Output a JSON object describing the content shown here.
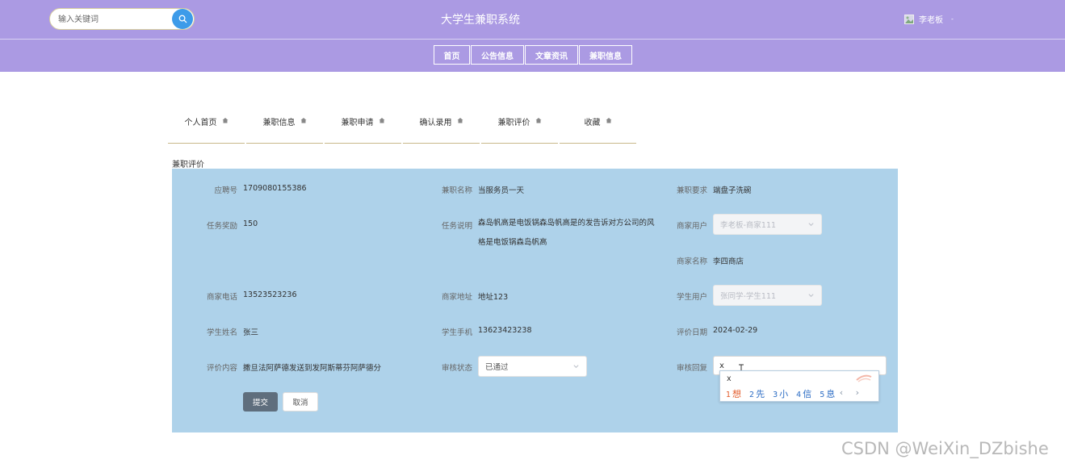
{
  "header": {
    "search_placeholder": "输入关键词",
    "site_title": "大学生兼职系统",
    "user_name": "李老板",
    "user_caret": "-"
  },
  "nav": [
    {
      "label": "首页"
    },
    {
      "label": "公告信息"
    },
    {
      "label": "文章资讯"
    },
    {
      "label": "兼职信息"
    }
  ],
  "tabs": [
    {
      "label": "个人首页"
    },
    {
      "label": "兼职信息"
    },
    {
      "label": "兼职申请"
    },
    {
      "label": "确认录用"
    },
    {
      "label": "兼职评价"
    },
    {
      "label": "收藏"
    }
  ],
  "section_title": "兼职评价",
  "form": {
    "apply_no": {
      "label": "应聘号",
      "value": "1709080155386"
    },
    "job_name": {
      "label": "兼职名称",
      "value": "当服务员一天"
    },
    "job_req": {
      "label": "兼职要求",
      "value": "端盘子洗碗"
    },
    "reward": {
      "label": "任务奖励",
      "value": "150"
    },
    "task_desc": {
      "label": "任务说明",
      "value": "森岛帆高是电饭锅森岛帆高是的发告诉对方公司的风格是电饭锅森岛帆高"
    },
    "merchant_user": {
      "label": "商家用户",
      "value": "李老板-商家111"
    },
    "merchant_name": {
      "label": "商家名称",
      "value": "李四商店"
    },
    "merchant_phone": {
      "label": "商家电话",
      "value": "13523523236"
    },
    "merchant_addr": {
      "label": "商家地址",
      "value": "地址123"
    },
    "student_user": {
      "label": "学生用户",
      "value": "张同学-学生111"
    },
    "student_name": {
      "label": "学生姓名",
      "value": "张三"
    },
    "student_phone": {
      "label": "学生手机",
      "value": "13623423238"
    },
    "eval_date": {
      "label": "评价日期",
      "value": "2024-02-29"
    },
    "eval_content": {
      "label": "评价内容",
      "value": "撒旦法阿萨德发送到发阿斯蒂芬阿萨德分"
    },
    "review_status": {
      "label": "审核状态",
      "value": "已通过"
    },
    "review_reply": {
      "label": "审核回复",
      "value": "x"
    }
  },
  "ime": {
    "pinyin": "x",
    "candidates": [
      {
        "num": "1",
        "char": "想"
      },
      {
        "num": "2",
        "char": "先"
      },
      {
        "num": "3",
        "char": "小"
      },
      {
        "num": "4",
        "char": "信"
      },
      {
        "num": "5",
        "char": "息"
      }
    ],
    "nav": "‹ ›"
  },
  "buttons": {
    "submit": "提交",
    "cancel": "取消"
  },
  "watermark": "CSDN @WeiXin_DZbishe",
  "colors": {
    "header_bg": "#ab9ae3",
    "panel_bg": "#aed2ea",
    "search_btn": "#3d9be9",
    "submit_btn": "#5f6e7d"
  }
}
